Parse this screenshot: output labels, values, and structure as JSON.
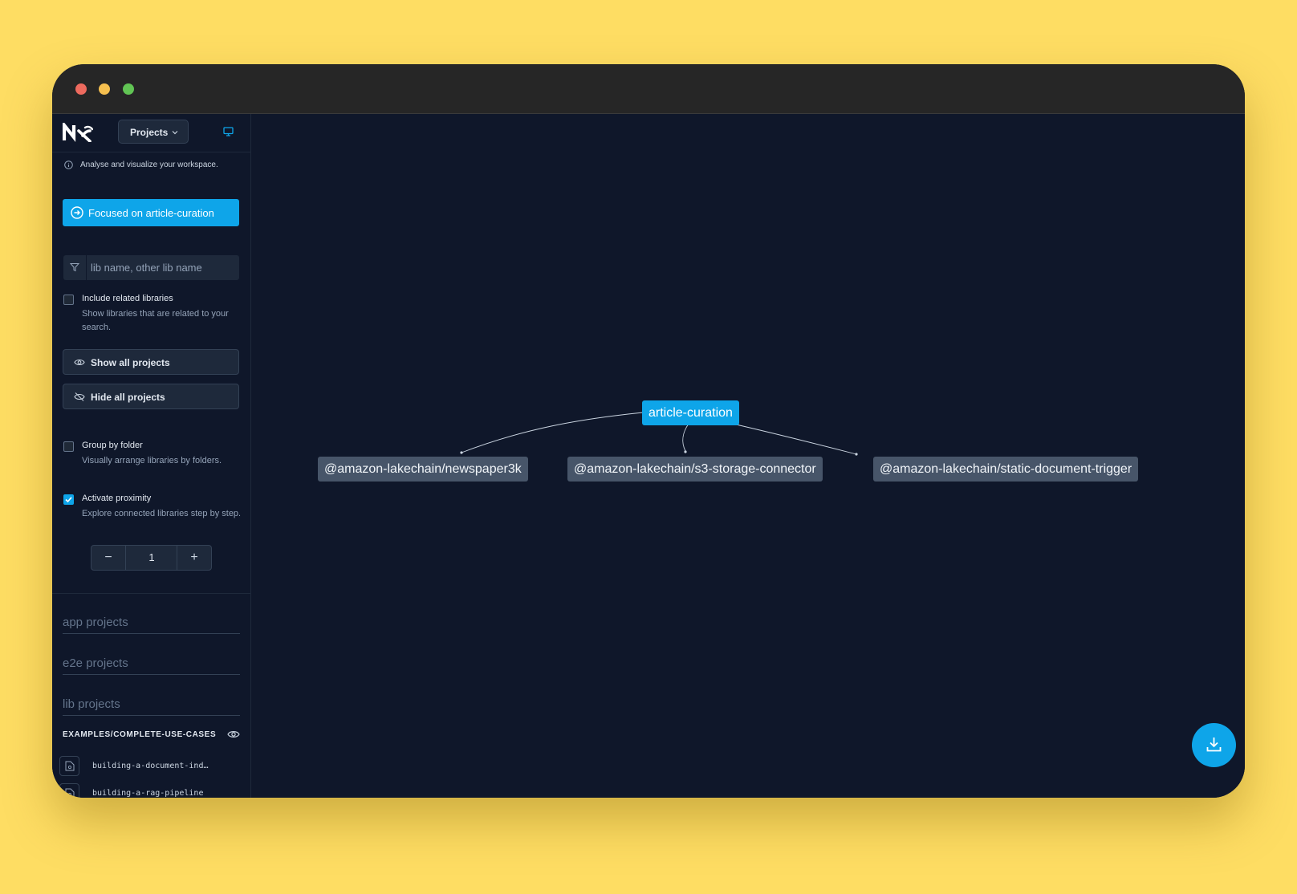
{
  "colors": {
    "background": "#fedd63",
    "window": "#0f172a",
    "accent": "#0ea5e9",
    "node_dependency": "#475569"
  },
  "header": {
    "logo": "Nx",
    "view_select": "Projects",
    "view_select_icon": "chevron-down-icon",
    "monitor_icon": "monitor-icon"
  },
  "sidebar": {
    "info_text": "Analyse and visualize your workspace.",
    "focus_button": "Focused on article-curation",
    "filter": {
      "placeholder": "lib name, other lib name",
      "value": ""
    },
    "include_related": {
      "checked": false,
      "title": "Include related libraries",
      "description": "Show libraries that are related to your search."
    },
    "show_all": "Show all projects",
    "hide_all": "Hide all projects",
    "group_by_folder": {
      "checked": false,
      "title": "Group by folder",
      "description": "Visually arrange libraries by folders."
    },
    "activate_proximity": {
      "checked": true,
      "title": "Activate proximity",
      "description": "Explore connected libraries step by step."
    },
    "proximity": {
      "minus": "−",
      "value": "1",
      "plus": "+"
    },
    "groups": [
      "app projects",
      "e2e projects",
      "lib projects"
    ],
    "folder": {
      "name": "EXAMPLES/COMPLETE-USE-CASES",
      "items": [
        "building-a-document-ind…",
        "building-a-rag-pipeline"
      ]
    }
  },
  "graph": {
    "focused_node": "article-curation",
    "dependencies": [
      "@amazon-lakechain/newspaper3k",
      "@amazon-lakechain/s3-storage-connector",
      "@amazon-lakechain/static-document-trigger"
    ]
  },
  "download_button": "download-icon"
}
